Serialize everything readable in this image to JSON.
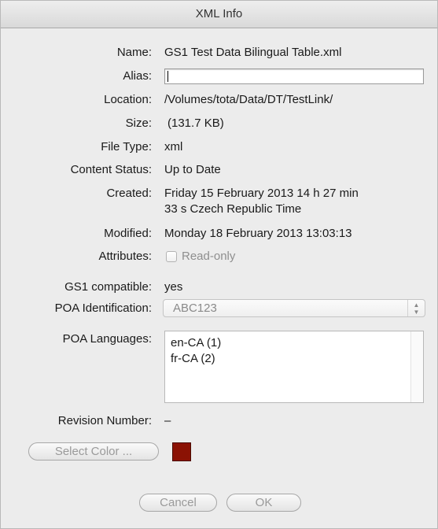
{
  "window": {
    "title": "XML Info"
  },
  "fields": {
    "name": {
      "label": "Name:",
      "value": "GS1 Test Data Bilingual Table.xml"
    },
    "alias": {
      "label": "Alias:",
      "value": ""
    },
    "location": {
      "label": "Location:",
      "value": "/Volumes/tota/Data/DT/TestLink/"
    },
    "size": {
      "label": "Size:",
      "value": "(131.7 KB)"
    },
    "file_type": {
      "label": "File Type:",
      "value": "xml"
    },
    "content_status": {
      "label": "Content Status:",
      "value": "Up to Date"
    },
    "created": {
      "label": "Created:",
      "value_line1": "Friday 15 February 2013 14 h 27 min",
      "value_line2": "33 s Czech Republic Time"
    },
    "modified": {
      "label": "Modified:",
      "value": "Monday 18 February 2013 13:03:13"
    },
    "attributes": {
      "label": "Attributes:",
      "readonly_label": "Read-only",
      "readonly_checked": false
    },
    "gs1_compatible": {
      "label": "GS1 compatible:",
      "value": "yes"
    },
    "poa_identification": {
      "label": "POA Identification:",
      "selected": "ABC123"
    },
    "poa_languages": {
      "label": "POA Languages:",
      "items": [
        "en-CA (1)",
        "fr-CA (2)"
      ]
    },
    "revision_number": {
      "label": "Revision Number:",
      "value": "–"
    }
  },
  "color": {
    "button_label": "Select Color ...",
    "swatch": "#8b1204"
  },
  "buttons": {
    "cancel": "Cancel",
    "ok": "OK"
  }
}
